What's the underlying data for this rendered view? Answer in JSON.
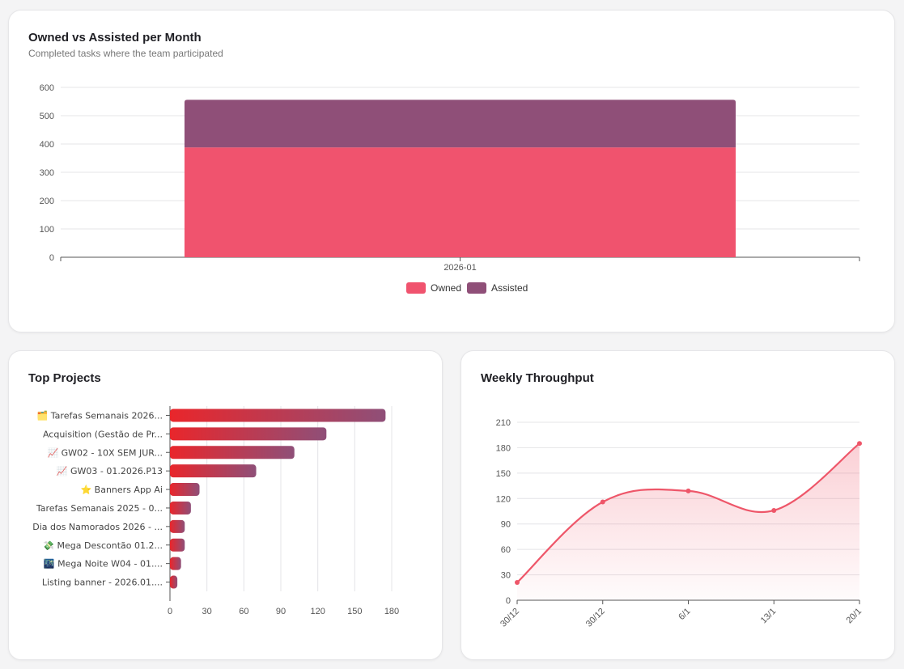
{
  "owned_card": {
    "title": "Owned vs Assisted per Month",
    "subtitle": "Completed tasks where the team participated"
  },
  "projects_card": {
    "title": "Top Projects"
  },
  "weekly_card": {
    "title": "Weekly Throughput"
  },
  "colors": {
    "owned": "#f0536e",
    "assisted": "#8f4f78",
    "bar_gradient_start": "#e9262b",
    "bar_gradient_end": "#8f4f78",
    "line": "#ee5669",
    "grid": "#e4e4e7"
  },
  "chart_data": [
    {
      "id": "owned-vs-assisted",
      "type": "bar",
      "stacked": true,
      "categories": [
        "2026-01"
      ],
      "series": [
        {
          "name": "Owned",
          "values": [
            388
          ]
        },
        {
          "name": "Assisted",
          "values": [
            168
          ]
        }
      ],
      "ylim": [
        0,
        600
      ],
      "yticks": [
        "0",
        "100",
        "200",
        "300",
        "400",
        "500",
        "600"
      ],
      "grid": true,
      "legend": "bottom-center"
    },
    {
      "id": "top-projects",
      "type": "bar",
      "orientation": "horizontal",
      "categories": [
        {
          "icon": "🗂️",
          "label": "Tarefas Semanais 2026..."
        },
        {
          "icon": "",
          "label": "Acquisition (Gestão de Pr..."
        },
        {
          "icon": "📈",
          "label": "GW02 - 10X SEM JUR..."
        },
        {
          "icon": "📈",
          "label": "GW03 - 01.2026.P13"
        },
        {
          "icon": "⭐",
          "label": "Banners App Ai"
        },
        {
          "icon": "",
          "label": "Tarefas Semanais 2025 - 0..."
        },
        {
          "icon": "",
          "label": "Dia dos Namorados 2026 - ..."
        },
        {
          "icon": "💸",
          "label": "Mega Descontão 01.2..."
        },
        {
          "icon": "🌃",
          "label": "Mega Noite W04 - 01...."
        },
        {
          "icon": "",
          "label": "Listing banner - 2026.01...."
        }
      ],
      "values": [
        175,
        127,
        101,
        70,
        24,
        17,
        12,
        12,
        9,
        6
      ],
      "xlim": [
        0,
        180
      ],
      "xticks": [
        "0",
        "30",
        "60",
        "90",
        "120",
        "150",
        "180"
      ],
      "grid": true
    },
    {
      "id": "weekly-throughput",
      "type": "area",
      "x": [
        "30/12",
        "30/12",
        "6/1",
        "13/1",
        "20/1"
      ],
      "values": [
        21,
        116,
        129,
        106,
        185
      ],
      "ylim": [
        0,
        210
      ],
      "yticks": [
        "0",
        "30",
        "60",
        "90",
        "120",
        "150",
        "180",
        "210"
      ],
      "grid": true
    }
  ]
}
